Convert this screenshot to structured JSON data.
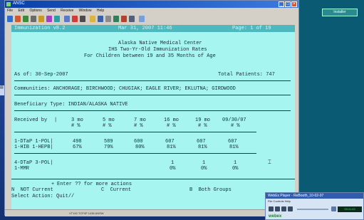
{
  "window": {
    "title": "ANSC",
    "menus": [
      "File",
      "Edit",
      "Options",
      "Send",
      "Receive",
      "Window",
      "Help"
    ],
    "status": "VT100 TCP/IP 1436 ANSW"
  },
  "terminal": {
    "header_left": "Immunization v8.2",
    "header_mid": "Mar 31, 2007 11:46",
    "header_right": "Page: 1 of 19",
    "org": "Alaska Native Medical Center",
    "report_title": "IHS Two-Yr-Old Immunization Rates",
    "report_subtitle": "For Children between 19 and 35 Months of Age",
    "as_of": "As of: 30-Sep-2007",
    "total_patients": "Total Patients: 747",
    "communities": "Communities: ANCHORAGE; BIRCHWOOD; CHUGIAK; EAGLE RIVER; EKLUTNA; GIRDWOOD",
    "beneficiary": "Beneficiary Type: INDIAN/ALASKA NATIVE",
    "received_by": "Received by",
    "columns": [
      {
        "label": "3 mo",
        "sub": "# %"
      },
      {
        "label": "5 mo",
        "sub": "# %"
      },
      {
        "label": "7 mo",
        "sub": "# %"
      },
      {
        "label": "16 mo",
        "sub": "# %"
      },
      {
        "label": "19 mo",
        "sub": "# %"
      },
      {
        "label": "09/30/07",
        "sub": "# %"
      }
    ],
    "rows": [
      {
        "label1": "1-DTaP 1-POL|",
        "label2": "1-HIB 1-HEPB|",
        "counts": [
          "498",
          "589",
          "600",
          "607",
          "607",
          "607"
        ],
        "pcts": [
          "67%",
          "79%",
          "80%",
          "81%",
          "81%",
          "81%"
        ]
      },
      {
        "label1": "4-DTaP 3-POL|",
        "label2": "1-MMR",
        "counts": [
          "",
          "",
          "",
          "1",
          "1",
          "1"
        ],
        "pcts": [
          "",
          "",
          "",
          "0%",
          "0%",
          "0%"
        ]
      }
    ],
    "prompt": "Enter ?? for more actions",
    "action_n": "N  NOT Current",
    "action_c": "C  Current",
    "action_b": "B  Both Groups",
    "select": "Select Action: Quit//"
  },
  "player": {
    "title": "WebEx Player - ReBooth_10-02-07",
    "menus": "File  Controls  Help",
    "time": "00:11:43",
    "logo": "webex"
  },
  "right_button": "Installer"
}
